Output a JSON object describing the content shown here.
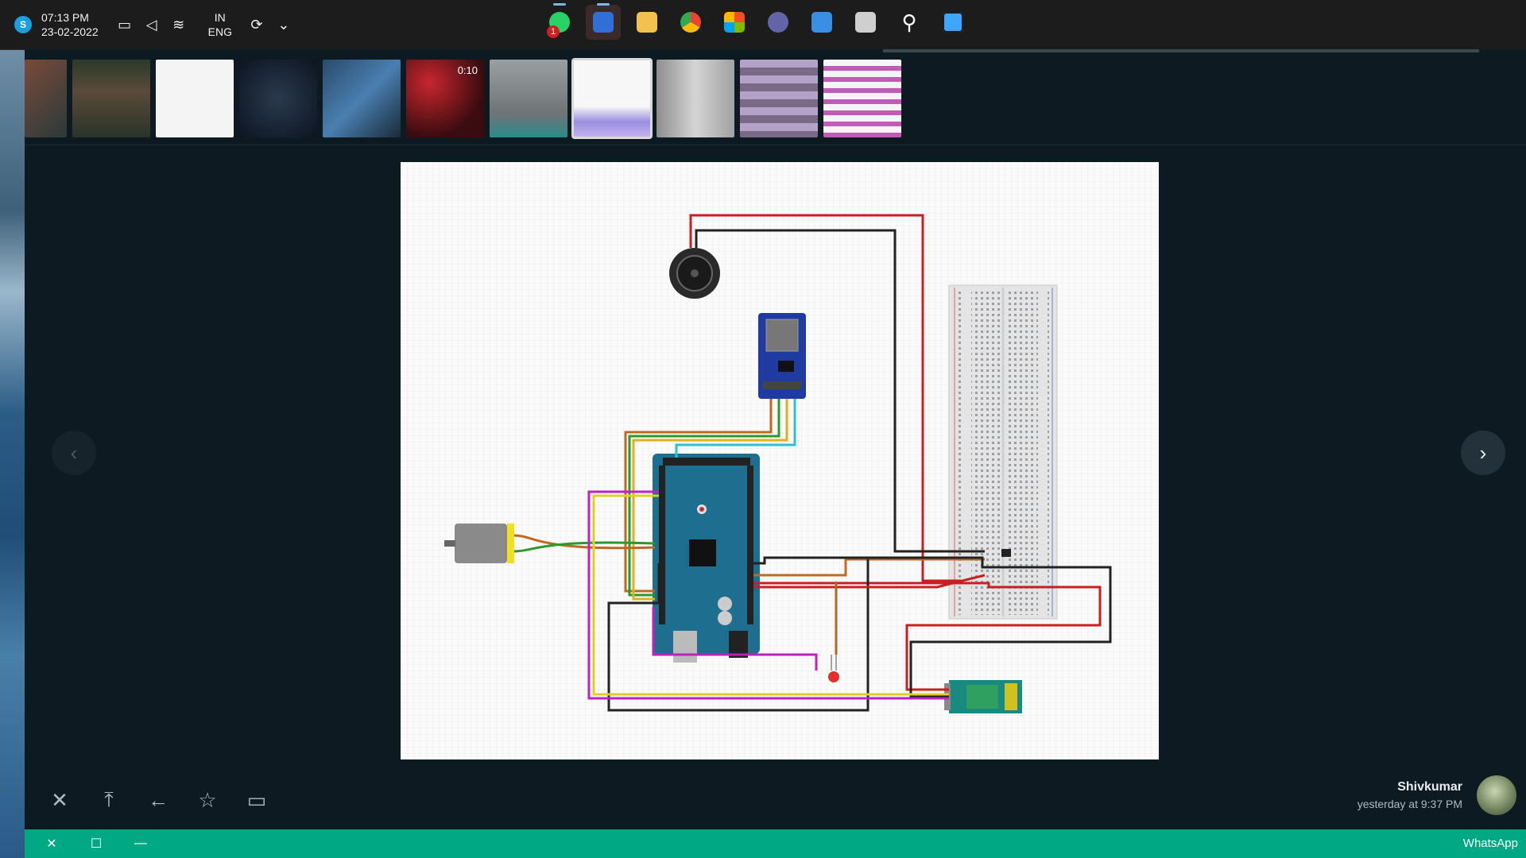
{
  "taskbar": {
    "badge": "S",
    "time": "07:13 PM",
    "date": "23-02-2022",
    "lang_top": "IN",
    "lang_bottom": "ENG",
    "apps": [
      {
        "name": "whatsapp",
        "color": "#25d366",
        "notifications": "1"
      },
      {
        "name": "mail",
        "color": "#2f6fd6"
      },
      {
        "name": "file-explorer",
        "color": "#f2c14e"
      },
      {
        "name": "chrome",
        "color": "#4285f4"
      },
      {
        "name": "microsoft-store",
        "color": "#f25022"
      },
      {
        "name": "teams-chat",
        "color": "#6264a7"
      },
      {
        "name": "widgets",
        "color": "#3a8ee6"
      },
      {
        "name": "task-view",
        "color": "#cfcfcf"
      },
      {
        "name": "search",
        "color": "#ffffff"
      },
      {
        "name": "start",
        "color": "#3ea6ff"
      }
    ]
  },
  "viewer": {
    "thumbnails": [
      {
        "color": "#7a4a3a",
        "duration": ""
      },
      {
        "color": "#3a4a3a",
        "duration": ""
      },
      {
        "color": "#f4f4f4",
        "duration": ""
      },
      {
        "color": "#14202e",
        "duration": ""
      },
      {
        "color": "#2f5f8a",
        "duration": ""
      },
      {
        "color": "#8a1f24",
        "duration": "0:10"
      },
      {
        "color": "#8e9496",
        "duration": ""
      },
      {
        "color": "#e9e6f4",
        "duration": ""
      },
      {
        "color": "#bdbdbd",
        "duration": ""
      },
      {
        "color": "#b5a2c9",
        "duration": ""
      },
      {
        "color": "#f7f3fb",
        "duration": ""
      }
    ],
    "prev_icon": "‹",
    "next_icon": "›"
  },
  "actions": {
    "close_icon": "✕",
    "download_icon": "⤒",
    "back_icon": "←",
    "star_icon": "☆",
    "share_icon": "▭"
  },
  "sender": {
    "name": "Shivkumar",
    "time": "yesterday at 9:37 PM"
  },
  "titlebar": {
    "app_name": "WhatsApp",
    "close": "✕",
    "maximize": "☐",
    "minimize": "—"
  }
}
